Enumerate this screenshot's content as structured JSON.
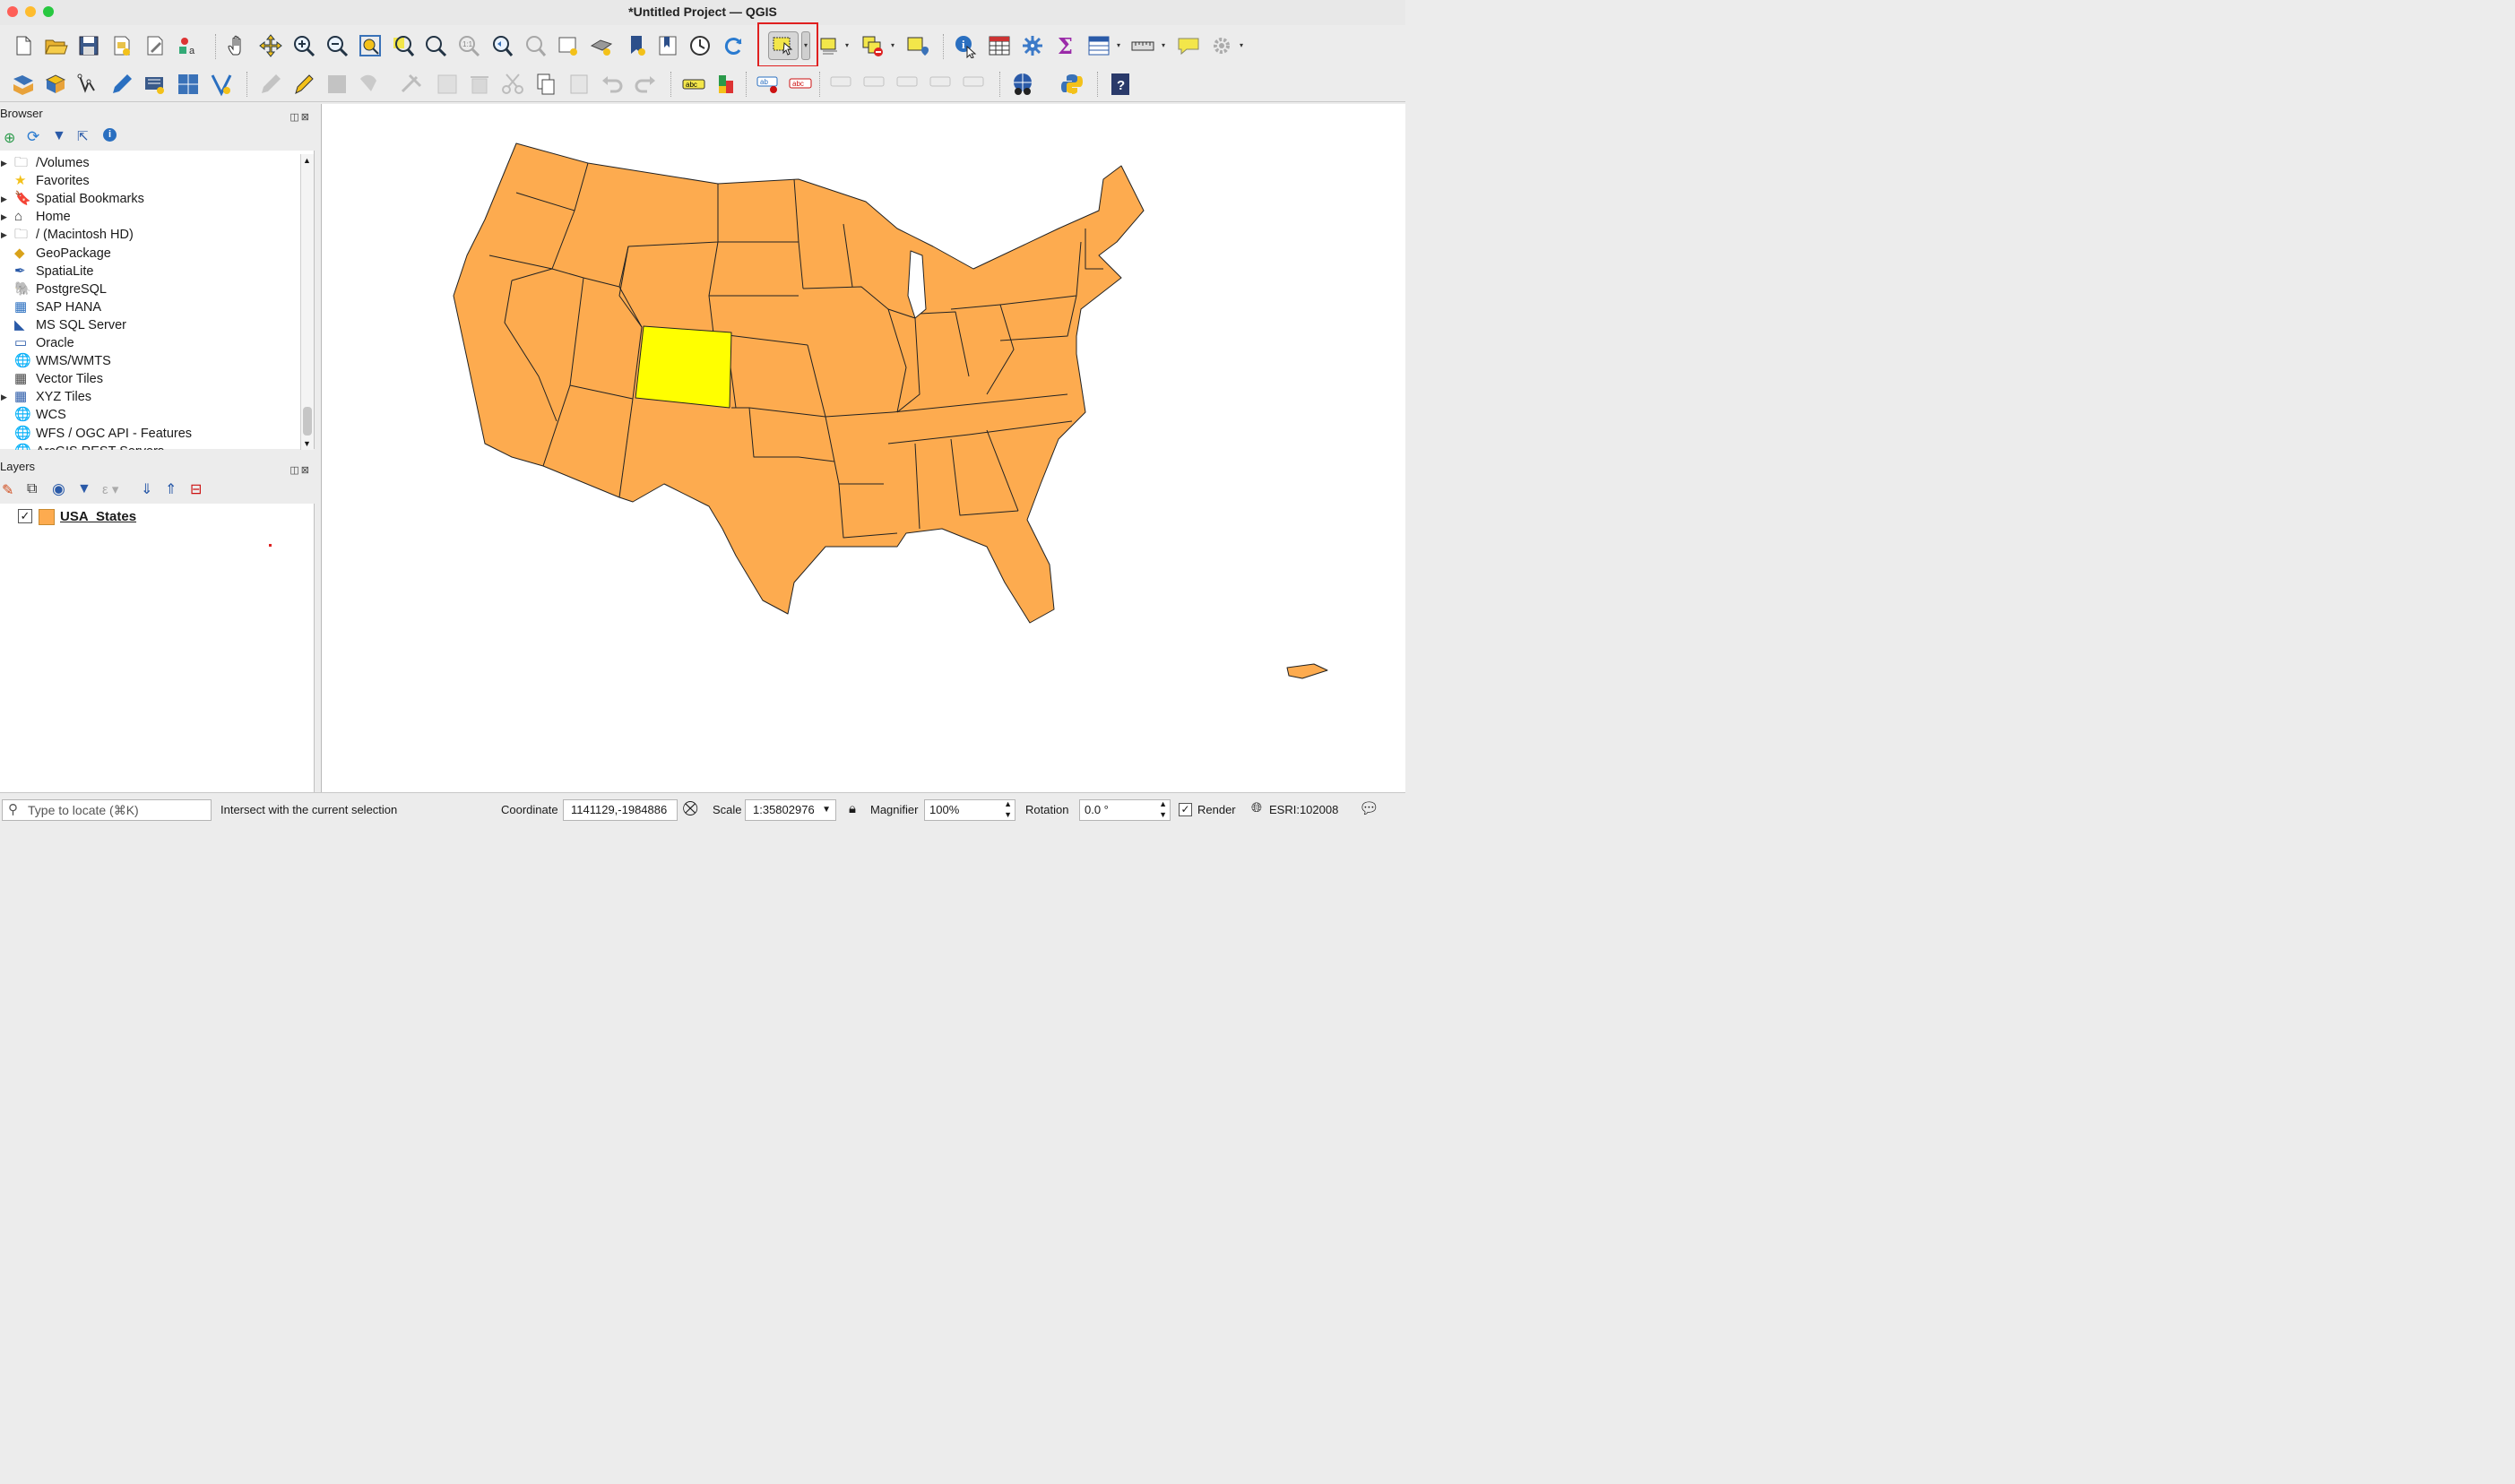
{
  "window": {
    "title": "*Untitled Project — QGIS"
  },
  "toolbar_top": {
    "icons": [
      "new-project-icon",
      "open-project-icon",
      "save-project-icon",
      "new-print-layout-icon",
      "style-manager-icon",
      "identify-lines-icon",
      "pan-icon",
      "pan-to-selection-icon",
      "zoom-in-icon",
      "zoom-out-icon",
      "zoom-full-icon",
      "zoom-to-selection-icon",
      "zoom-to-layer-icon",
      "zoom-native-icon",
      "zoom-last-icon",
      "zoom-next-icon",
      "new-map-view-icon",
      "new-3d-view-icon",
      "new-bookmark-icon",
      "show-bookmarks-icon",
      "temporal-controller-icon",
      "refresh-icon",
      "select-features-icon",
      "select-by-value-icon",
      "deselect-features-icon",
      "select-by-location-icon",
      "identify-features-icon",
      "attribute-table-icon",
      "processing-toolbox-icon",
      "statistics-icon",
      "field-calculator-icon",
      "measure-icon",
      "map-tips-icon",
      "settings-gear-icon"
    ],
    "highlighted_tool": "select-features-icon"
  },
  "toolbar_digitize": {
    "icons": [
      "add-vector-layer-icon",
      "add-raster-layer-icon",
      "add-delimited-text-icon",
      "edit-pencil-icon",
      "save-edits-icon",
      "digitize-icon",
      "vertex-tool-icon",
      "delete-selected-icon",
      "cut-icon",
      "copy-icon",
      "paste-icon",
      "undo-icon",
      "redo-icon",
      "label-icon",
      "diagram-icon",
      "label-pin-icon",
      "label-highlight-icon",
      "python-icon",
      "help-icon"
    ]
  },
  "browser": {
    "title": "Browser",
    "items": [
      {
        "label": "/Volumes",
        "icon": "folder-icon",
        "expandable": true
      },
      {
        "label": "Favorites",
        "icon": "star-icon",
        "expandable": false
      },
      {
        "label": "Spatial Bookmarks",
        "icon": "bookmark-icon",
        "expandable": true
      },
      {
        "label": "Home",
        "icon": "home-icon",
        "expandable": true
      },
      {
        "label": "/ (Macintosh HD)",
        "icon": "folder-icon",
        "expandable": true
      },
      {
        "label": "GeoPackage",
        "icon": "geopackage-icon",
        "expandable": false
      },
      {
        "label": "SpatiaLite",
        "icon": "spatialite-icon",
        "expandable": false
      },
      {
        "label": "PostgreSQL",
        "icon": "postgresql-icon",
        "expandable": false
      },
      {
        "label": "SAP HANA",
        "icon": "sap-hana-icon",
        "expandable": false
      },
      {
        "label": "MS SQL Server",
        "icon": "mssql-icon",
        "expandable": false
      },
      {
        "label": "Oracle",
        "icon": "oracle-icon",
        "expandable": false
      },
      {
        "label": "WMS/WMTS",
        "icon": "wms-icon",
        "expandable": false
      },
      {
        "label": "Vector Tiles",
        "icon": "vector-tiles-icon",
        "expandable": false
      },
      {
        "label": "XYZ Tiles",
        "icon": "xyz-tiles-icon",
        "expandable": true
      },
      {
        "label": "WCS",
        "icon": "wcs-icon",
        "expandable": false
      },
      {
        "label": "WFS / OGC API - Features",
        "icon": "wfs-icon",
        "expandable": false
      },
      {
        "label": "ArcGIS REST Servers",
        "icon": "arcgis-icon",
        "expandable": false
      }
    ]
  },
  "layers": {
    "title": "Layers",
    "items": [
      {
        "label": "USA_States",
        "checked": true,
        "color": "#fdab4f"
      }
    ]
  },
  "map": {
    "fill_color": "#fdab4f",
    "selected_color": "#ffff00",
    "selected_feature": "Colorado"
  },
  "statusbar": {
    "locate_placeholder": "Type to locate (⌘K)",
    "message": "Intersect with the current selection",
    "coordinate_label": "Coordinate",
    "coordinate_value": "1141129,-1984886",
    "scale_label": "Scale",
    "scale_value": "1:35802976",
    "magnifier_label": "Magnifier",
    "magnifier_value": "100%",
    "rotation_label": "Rotation",
    "rotation_value": "0.0 °",
    "render_label": "Render",
    "crs": "ESRI:102008"
  }
}
